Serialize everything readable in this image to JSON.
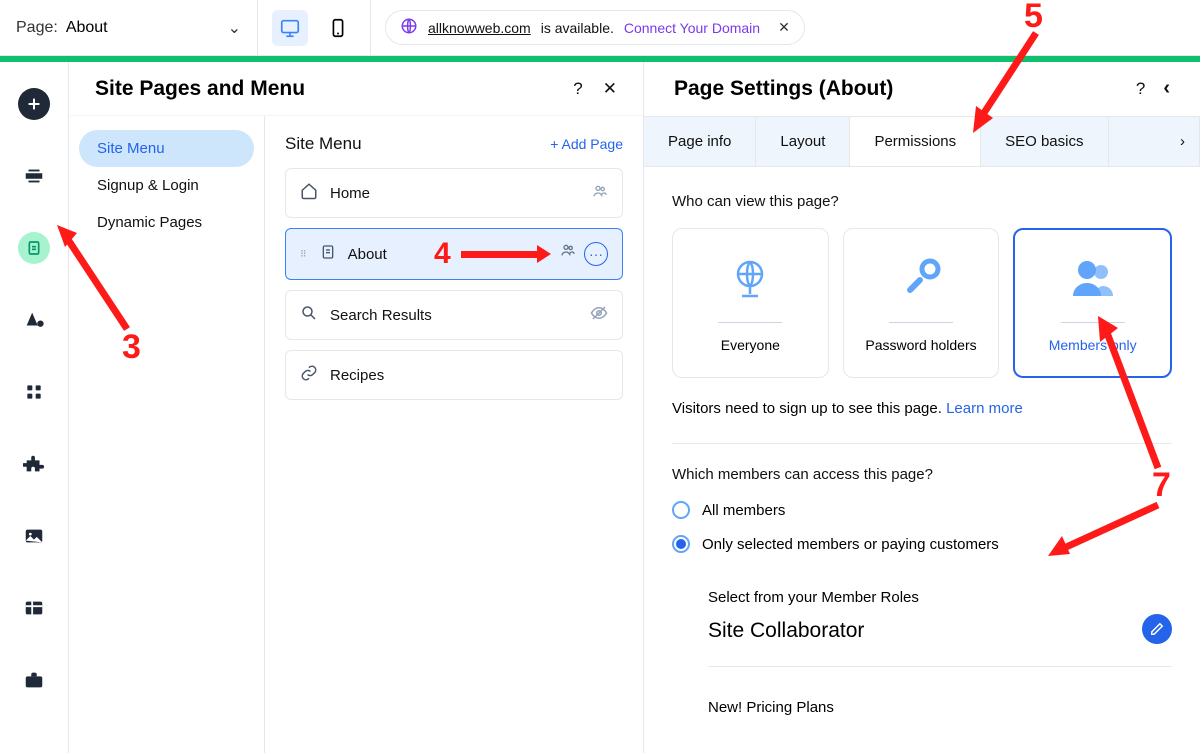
{
  "topbar": {
    "page_label": "Page:",
    "page_value": "About",
    "domain": "allknowweb.com",
    "available_text": "is available.",
    "connect_text": "Connect Your Domain"
  },
  "pages_panel": {
    "title": "Site Pages and Menu",
    "help_icon": "?",
    "close_icon": "✕",
    "left_tabs": {
      "site_menu": "Site Menu",
      "signup_login": "Signup & Login",
      "dynamic_pages": "Dynamic Pages"
    },
    "right_header": "Site Menu",
    "add_page": "+  Add Page",
    "pages": {
      "home": "Home",
      "about": "About",
      "search": "Search Results",
      "recipes": "Recipes"
    }
  },
  "settings_panel": {
    "title": "Page Settings (About)",
    "tabs": {
      "info": "Page info",
      "layout": "Layout",
      "permissions": "Permissions",
      "seo": "SEO basics"
    },
    "who_view": "Who can view this page?",
    "cards": {
      "everyone": "Everyone",
      "password": "Password holders",
      "members": "Members only"
    },
    "learn_text_1": "Visitors need to sign up to see this page. ",
    "learn_link": "Learn more",
    "which_members": "Which members can access this page?",
    "radios": {
      "all": "All members",
      "selected": "Only selected members or paying customers"
    },
    "roles_heading": "Select from your Member Roles",
    "role_name": "Site Collaborator",
    "new_plans": "New! Pricing Plans"
  },
  "annotations": {
    "n3": "3",
    "n4": "4",
    "n5": "5",
    "n7": "7"
  }
}
